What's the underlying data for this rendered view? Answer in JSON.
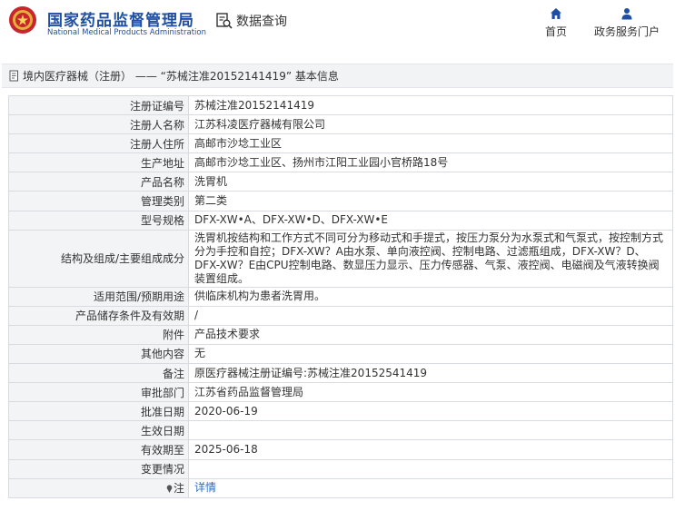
{
  "header": {
    "site_name": "国家药品监督管理局",
    "site_name_en": "National Medical Products Administration",
    "data_query_label": "数据查询",
    "nav": [
      {
        "label": "首页",
        "icon": "home-icon"
      },
      {
        "label": "政务服务门户",
        "icon": "user-icon"
      }
    ]
  },
  "breadcrumb": {
    "text": "境内医疗器械（注册） —— “苏械注准20152141419” 基本信息",
    "icon": "document-icon"
  },
  "rows": [
    {
      "label": "注册证编号",
      "value": "苏械注准20152141419"
    },
    {
      "label": "注册人名称",
      "value": "江苏科凌医疗器械有限公司"
    },
    {
      "label": "注册人住所",
      "value": "高邮市沙埝工业区"
    },
    {
      "label": "生产地址",
      "value": "高邮市沙埝工业区、扬州市江阳工业园小官桥路18号"
    },
    {
      "label": "产品名称",
      "value": "洗胃机"
    },
    {
      "label": "管理类别",
      "value": "第二类"
    },
    {
      "label": "型号规格",
      "value": "DFX-XW•A、DFX-XW•D、DFX-XW•E"
    },
    {
      "label": "结构及组成/主要组成成分",
      "value": "洗胃机按结构和工作方式不同可分为移动式和手提式，按压力泵分为水泵式和气泵式，按控制方式分为手控和自控；DFX-XW？A由水泵、单向液控阀、控制电路、过滤瓶组成，DFX-XW？D、DFX-XW？E由CPU控制电路、数显压力显示、压力传感器、气泵、液控阀、电磁阀及气液转换阀装置组成。"
    },
    {
      "label": "适用范围/预期用途",
      "value": "供临床机构为患者洗胃用。"
    },
    {
      "label": "产品储存条件及有效期",
      "value": "/"
    },
    {
      "label": "附件",
      "value": "产品技术要求"
    },
    {
      "label": "其他内容",
      "value": "无"
    },
    {
      "label": "备注",
      "value": "原医疗器械注册证编号:苏械注准20152541419"
    },
    {
      "label": "审批部门",
      "value": "江苏省药品监督管理局"
    },
    {
      "label": "批准日期",
      "value": "2020-06-19"
    },
    {
      "label": "生效日期",
      "value": ""
    },
    {
      "label": "有效期至",
      "value": "2025-06-18"
    },
    {
      "label": "变更情况",
      "value": ""
    },
    {
      "label": "注",
      "value": "详情"
    }
  ],
  "colors": {
    "brand_blue": "#1f4fa3",
    "link_blue": "#2b6cc4",
    "label_bg": "#f3f4f6",
    "border": "#d8dbe0"
  }
}
